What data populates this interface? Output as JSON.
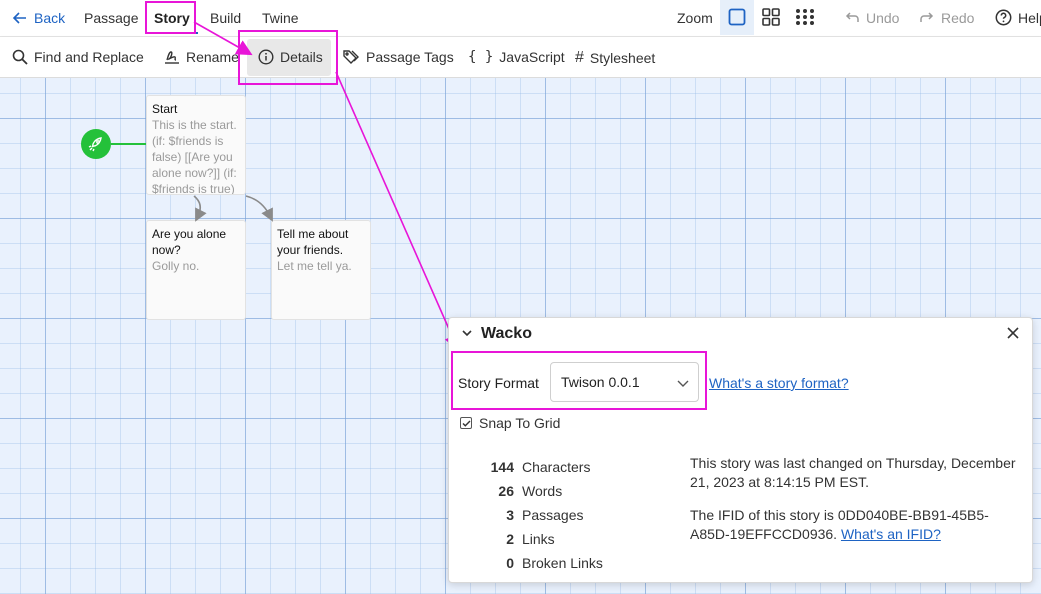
{
  "topbar": {
    "back": "Back",
    "tabs": [
      "Passage",
      "Story",
      "Build",
      "Twine"
    ],
    "zoom_label": "Zoom",
    "undo": "Undo",
    "redo": "Redo",
    "help": "Help"
  },
  "toolbar": {
    "find_replace": "Find and Replace",
    "rename": "Rename",
    "details": "Details",
    "passage_tags": "Passage Tags",
    "javascript": "JavaScript",
    "stylesheet": "Stylesheet"
  },
  "passages": [
    {
      "title": "Start",
      "excerpt": "This is the start. (if: $friends is false) [[Are you alone now?]] (if: $friends is true)"
    },
    {
      "title": "Are you alone now?",
      "excerpt": "Golly no."
    },
    {
      "title": "Tell me about your friends.",
      "excerpt": "Let me tell ya."
    }
  ],
  "dialog": {
    "title": "Wacko",
    "story_format_label": "Story Format",
    "story_format_value": "Twison 0.0.1",
    "story_format_link": "What's a story format?",
    "snap_to_grid": "Snap To Grid",
    "stats": [
      {
        "value": "144",
        "label": "Characters"
      },
      {
        "value": "26",
        "label": "Words"
      },
      {
        "value": "3",
        "label": "Passages"
      },
      {
        "value": "2",
        "label": "Links"
      },
      {
        "value": "0",
        "label": "Broken Links"
      }
    ],
    "last_changed": "This story was last changed on Thursday, December 21, 2023 at 8:14:15 PM EST.",
    "ifid_text": "The IFID of this story is 0DD040BE-BB91-45B5-A85D-19EFFCCD0936.",
    "ifid_link": "What's an IFID?"
  },
  "colors": {
    "accent": "#1e63c3",
    "highlight": "#e815d8",
    "start_green": "#24c13a"
  }
}
